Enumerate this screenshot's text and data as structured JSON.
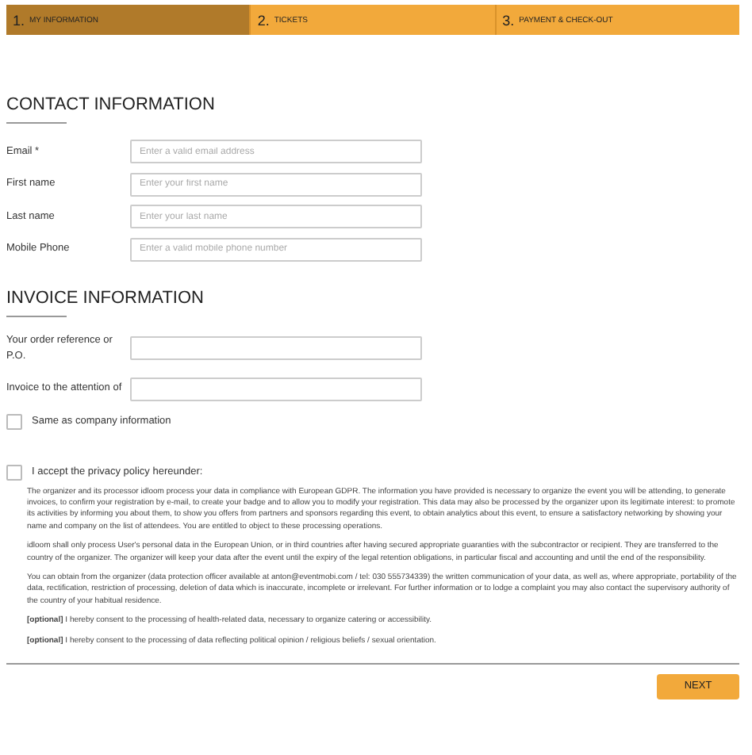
{
  "steps": [
    {
      "number": "1.",
      "label": "MY INFORMATION",
      "selected": true
    },
    {
      "number": "2.",
      "label": "TICKETS",
      "selected": false
    },
    {
      "number": "3.",
      "label": "PAYMENT & CHECK-OUT",
      "selected": false
    }
  ],
  "sections": [
    {
      "title": "CONTACT INFORMATION",
      "fields": [
        {
          "label": "Email *",
          "placeholder": "Enter a valid email address"
        },
        {
          "label": "First name",
          "placeholder": "Enter your first name"
        },
        {
          "label": "Last name",
          "placeholder": "Enter your last name"
        },
        {
          "label": "Mobile Phone",
          "placeholder": "Enter a valid mobile phone number"
        }
      ]
    },
    {
      "title": "INVOICE INFORMATION",
      "fields": [
        {
          "label": "Your order reference or P.O."
        },
        {
          "label": "Invoice to the attention of"
        }
      ],
      "checkbox": {
        "label": "Same as company information",
        "checked": false
      }
    }
  ],
  "privacy": {
    "label": "I accept the privacy policy hereunder:",
    "checked": false,
    "paragraphs": [
      "The organizer and its processor idloom process your data in compliance with European GDPR. The information you have provided is necessary to organize the event you will be attending, to generate invoices, to confirm your registration by e-mail, to create your badge and to allow you to modify your registration. This data may also be processed by the organizer upon its legitimate interest: to promote its activities by informing you about them, to show you offers from partners and sponsors regarding this event, to obtain analytics about this event, to ensure a satisfactory networking by showing your name and company on the list of attendees. You are entitled to object to these processing operations.",
      "idloom shall only process User's personal data in the European Union, or in third countries after having secured appropriate guaranties with the subcontractor or recipient. They are transferred to the country of the organizer. The organizer will keep your data after the event until the expiry of the legal retention obligations, in particular fiscal and accounting and until the end of the responsibility.",
      "You can obtain from the organizer (data protection officer available at anton@eventmobi.com / tel: 030 555734339) the written communication of your data, as well as, where appropriate, portability of the data, rectification, restriction of processing, deletion of data which is inaccurate, incomplete or irrelevant. For further information or to lodge a complaint you may also contact the supervisory authority of the country of your habitual residence.",
      "**[optional]** I hereby consent to the processing of health-related data, necessary to organize catering or accessibility.",
      "**[optional]** I hereby consent to the processing of data reflecting political opinion / religious beliefs / sexual orientation."
    ]
  },
  "next_button": "NEXT"
}
